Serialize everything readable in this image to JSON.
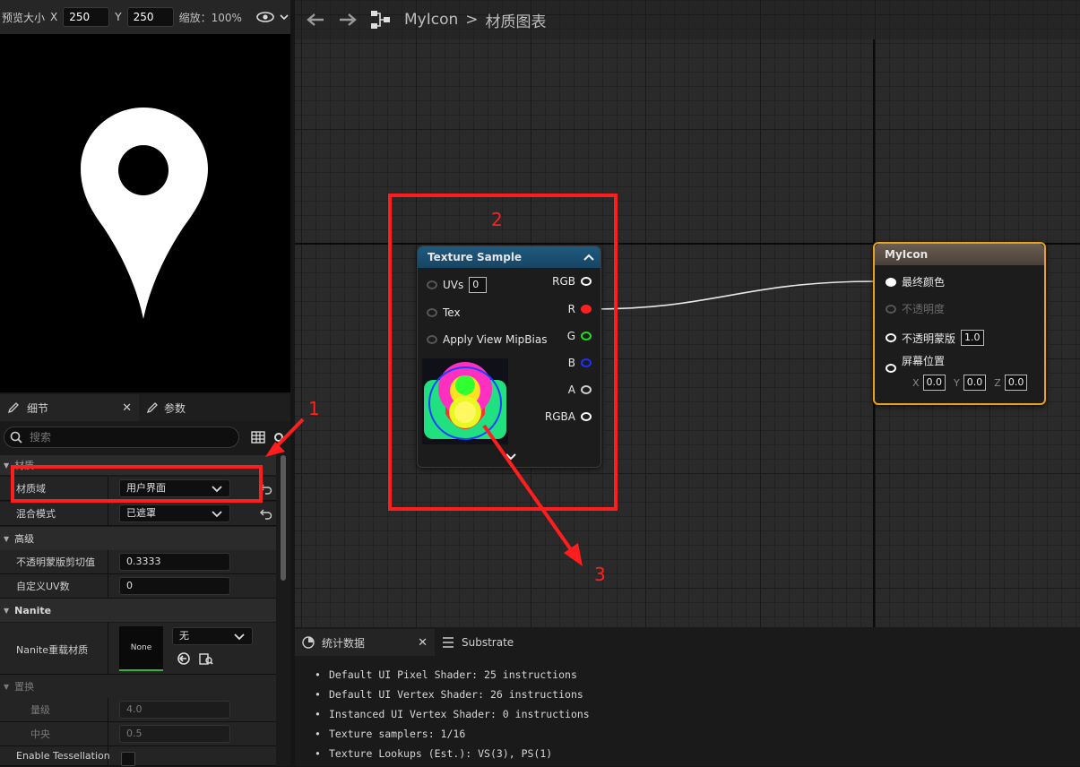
{
  "preview_toolbar": {
    "size_label": "预览大小",
    "x_label": "X",
    "x_value": "250",
    "y_label": "Y",
    "y_value": "250",
    "zoom_label": "缩放：100%"
  },
  "details_tabs": [
    {
      "label": "细节",
      "icon": "pencil-icon",
      "active": true
    },
    {
      "label": "参数",
      "icon": "pencil-icon",
      "active": false
    }
  ],
  "search": {
    "placeholder": "搜索"
  },
  "details": {
    "category_material": "材质",
    "material_domain": {
      "label": "材质域",
      "value": "用户界面"
    },
    "blend_mode": {
      "label": "混合模式",
      "value": "已遮罩"
    },
    "category_advanced": "高级",
    "opacity_mask_clip": {
      "label": "不透明蒙版剪切值",
      "value": "0.3333"
    },
    "custom_uvs": {
      "label": "自定义UV数",
      "value": "0"
    },
    "category_nanite": "Nanite",
    "nanite_override": {
      "label": "Nanite重载材质",
      "thumb": "None",
      "value": "无"
    },
    "category_displacement": "置换",
    "magnitude": {
      "label": "量级",
      "value": "4.0"
    },
    "center": {
      "label": "中央",
      "value": "0.5"
    },
    "tessellation": {
      "label": "Enable Tessellation"
    }
  },
  "graph": {
    "breadcrumb_root": "MyIcon",
    "breadcrumb_sep": ">",
    "breadcrumb_current": "材质图表",
    "texture_node": {
      "title": "Texture Sample",
      "inputs": [
        {
          "label": "UVs",
          "value": "0"
        },
        {
          "label": "Tex"
        },
        {
          "label": "Apply View MipBias"
        }
      ],
      "outputs": [
        {
          "label": "RGB",
          "color": "#ffffff"
        },
        {
          "label": "R",
          "color": "#ff2020"
        },
        {
          "label": "G",
          "color": "#20e020"
        },
        {
          "label": "B",
          "color": "#2030ff"
        },
        {
          "label": "A",
          "color": "#d0d0d0"
        },
        {
          "label": "RGBA",
          "color": "#ffffff"
        }
      ]
    },
    "result_node": {
      "title": "MyIcon",
      "pins": [
        {
          "label": "最终颜色"
        },
        {
          "label": "不透明度"
        },
        {
          "label": "不透明蒙版",
          "value": "1.0"
        },
        {
          "label": "屏幕位置",
          "x_label": "X",
          "x": "0.0",
          "y_label": "Y",
          "y": "0.0",
          "z_label": "Z",
          "z": "0.0"
        }
      ]
    }
  },
  "bottom_tabs": [
    {
      "label": "统计数据",
      "active": true
    },
    {
      "label": "Substrate",
      "active": false
    }
  ],
  "stats": [
    "Default UI Pixel Shader: 25 instructions",
    "Default UI Vertex Shader: 26 instructions",
    "Instanced UI Vertex Shader: 0 instructions",
    "Texture samplers: 1/16",
    "Texture Lookups (Est.): VS(3), PS(1)"
  ],
  "annotations": {
    "n1": "1",
    "n2": "2",
    "n3": "3"
  }
}
